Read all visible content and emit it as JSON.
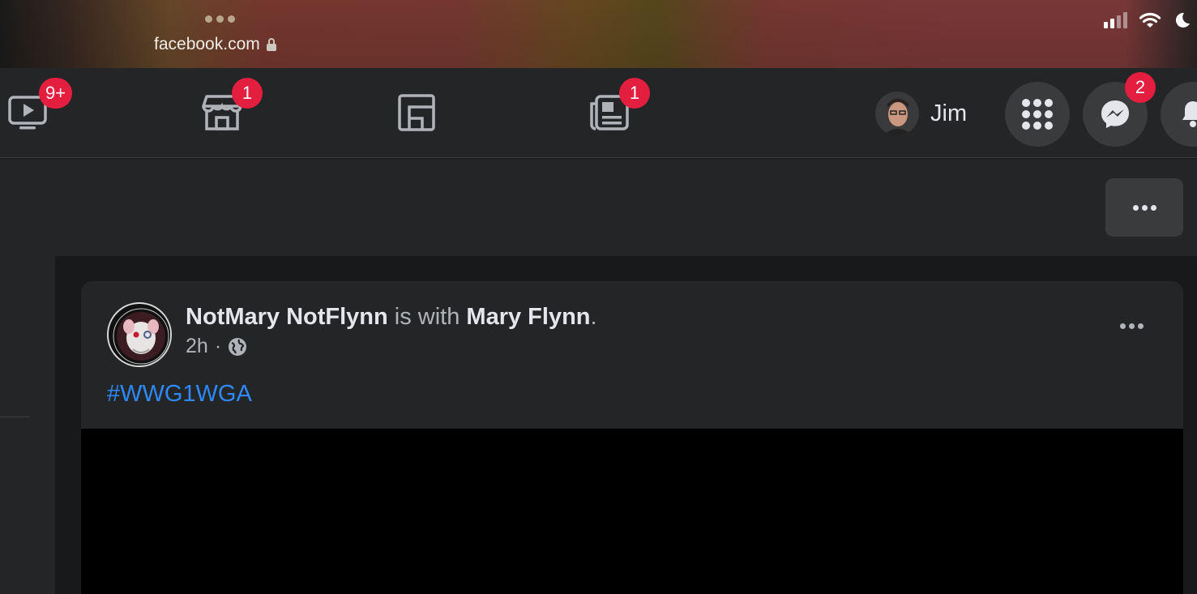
{
  "browser": {
    "url": "facebook.com"
  },
  "nav": {
    "watch_badge": "9+",
    "marketplace_badge": "1",
    "news_badge": "1",
    "profile_name": "Jim",
    "messenger_badge": "2"
  },
  "post": {
    "author": "NotMary NotFlynn",
    "with_text": "is with",
    "tagged": "Mary Flynn",
    "period": ".",
    "time": "2h",
    "separator": "·",
    "hashtag": "#WWG1WGA"
  },
  "colors": {
    "background": "#18191a",
    "surface": "#242526",
    "badge": "#e41e3f",
    "link": "#2e89ff"
  }
}
